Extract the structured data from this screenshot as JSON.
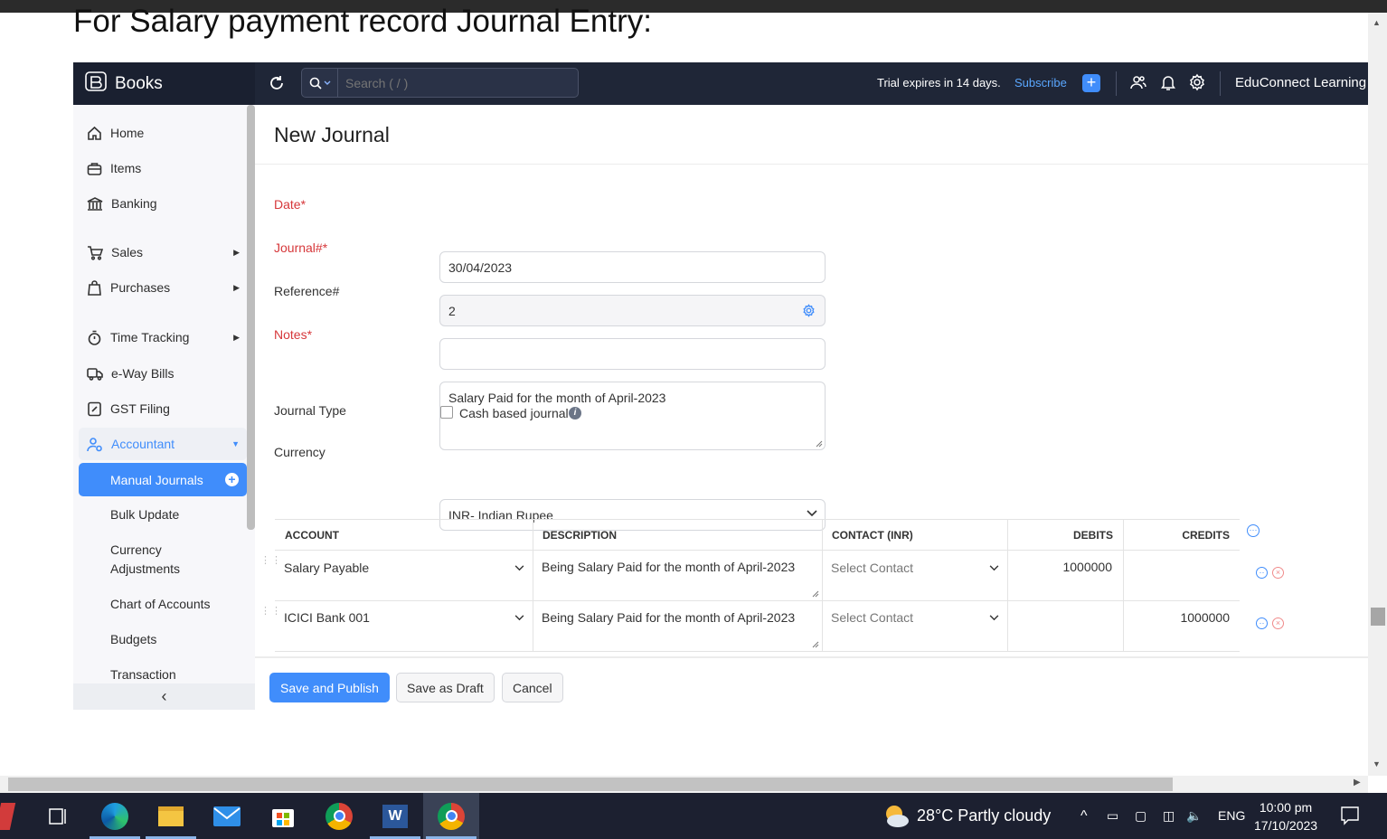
{
  "document": {
    "heading": "For Salary payment record Journal Entry:"
  },
  "topbar": {
    "brand": "Books",
    "search_placeholder": "Search ( / )",
    "trial_text": "Trial expires in 14 days.",
    "subscribe_label": "Subscribe",
    "org_name": "EduConnect Learning"
  },
  "sidebar": {
    "items": [
      {
        "label": "Home",
        "icon": "home-icon"
      },
      {
        "label": "Items",
        "icon": "items-icon"
      },
      {
        "label": "Banking",
        "icon": "bank-icon"
      },
      {
        "label": "Sales",
        "icon": "cart-icon"
      },
      {
        "label": "Purchases",
        "icon": "bag-icon"
      },
      {
        "label": "Time Tracking",
        "icon": "stopwatch-icon"
      },
      {
        "label": "e-Way Bills",
        "icon": "truck-icon"
      },
      {
        "label": "GST Filing",
        "icon": "gst-icon"
      },
      {
        "label": "Accountant",
        "icon": "accountant-icon"
      }
    ],
    "sub_items": [
      {
        "label": "Manual Journals"
      },
      {
        "label": "Bulk Update"
      },
      {
        "label": "Currency Adjustments"
      },
      {
        "label": "Chart of Accounts"
      },
      {
        "label": "Budgets"
      },
      {
        "label": "Transaction"
      }
    ],
    "accent_color": "#408dfb"
  },
  "form": {
    "title": "New Journal",
    "date_label": "Date*",
    "date_value": "30/04/2023",
    "journal_no_label": "Journal#*",
    "journal_no_value": "2",
    "reference_label": "Reference#",
    "reference_value": "",
    "notes_label": "Notes*",
    "notes_value": "Salary Paid for the month of April-2023",
    "journal_type_label": "Journal Type",
    "cash_based_label": "Cash based journal",
    "cash_based_checked": false,
    "currency_label": "Currency",
    "currency_value": "INR- Indian Rupee"
  },
  "grid": {
    "headers": {
      "account": "ACCOUNT",
      "description": "DESCRIPTION",
      "contact": "CONTACT (INR)",
      "debits": "DEBITS",
      "credits": "CREDITS"
    },
    "rows": [
      {
        "account": "Salary Payable",
        "description": "Being Salary Paid for the month of April-2023",
        "contact": "Select Contact",
        "debit": "1000000",
        "credit": ""
      },
      {
        "account": "ICICI Bank 001",
        "description": "Being Salary Paid for the month of April-2023",
        "contact": "Select Contact",
        "debit": "",
        "credit": "1000000"
      }
    ]
  },
  "actions": {
    "save_publish": "Save and Publish",
    "save_draft": "Save as Draft",
    "cancel": "Cancel"
  },
  "taskbar": {
    "weather": "28°C  Partly cloudy",
    "language": "ENG",
    "time": "10:00 pm",
    "date": "17/10/2023"
  }
}
